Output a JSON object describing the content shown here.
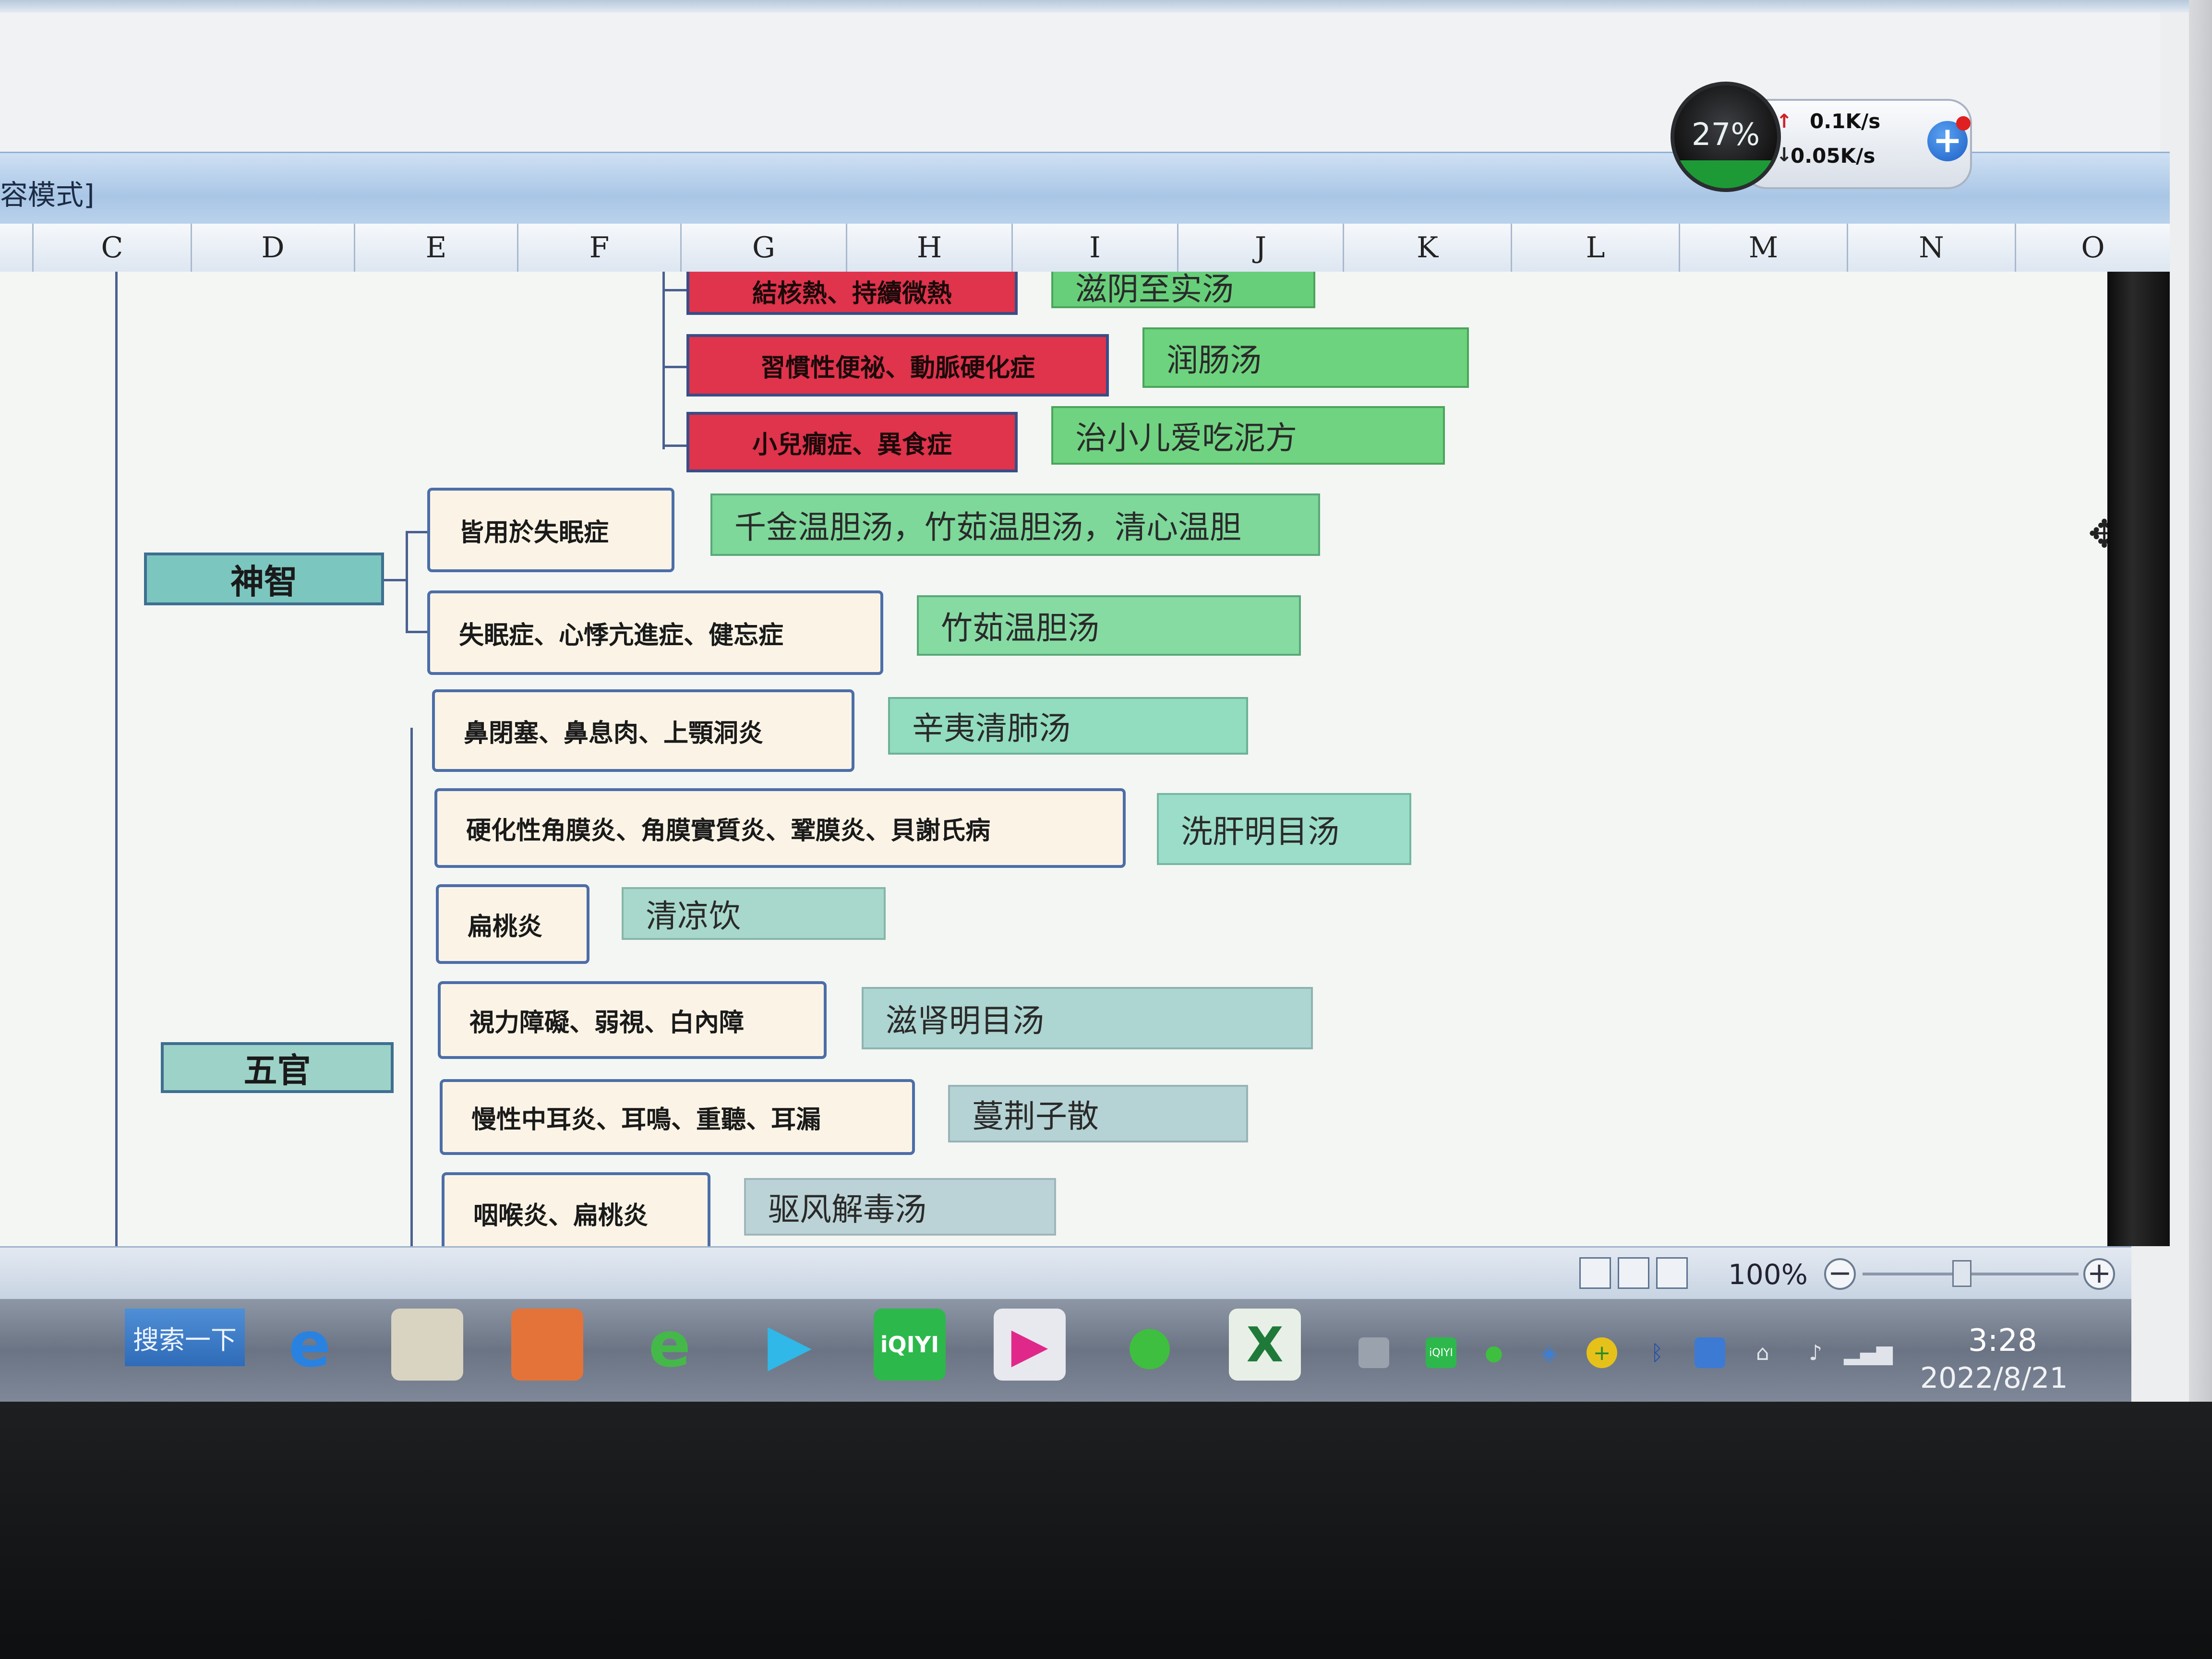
{
  "window": {
    "title_fragment": "容模式]"
  },
  "columns": [
    "C",
    "D",
    "E",
    "F",
    "G",
    "H",
    "I",
    "J",
    "K",
    "L",
    "M",
    "N",
    "O"
  ],
  "mindmap": {
    "red_nodes": [
      {
        "label": "結核熱、持續微熱",
        "remedy": "滋阴至实汤"
      },
      {
        "label": "習慣性便祕、動脈硬化症",
        "remedy": "润肠汤"
      },
      {
        "label": "小兒癇症、異食症",
        "remedy": "治小儿爱吃泥方"
      }
    ],
    "categories": [
      {
        "label": "神智",
        "symptoms": [
          {
            "label": "皆用於失眠症",
            "remedy": "千金温胆汤，竹茹温胆汤，清心温胆"
          },
          {
            "label": "失眠症、心悸亢進症、健忘症",
            "remedy": "竹茹温胆汤"
          }
        ]
      },
      {
        "label": "五官",
        "symptoms": [
          {
            "label": "鼻閉塞、鼻息肉、上顎洞炎",
            "remedy": "辛夷清肺汤"
          },
          {
            "label": "硬化性角膜炎、角膜實質炎、鞏膜炎、貝謝氏病",
            "remedy": "洗肝明目汤"
          },
          {
            "label": "扁桃炎",
            "remedy": "清凉饮"
          },
          {
            "label": "視力障礙、弱視、白內障",
            "remedy": "滋肾明目汤"
          },
          {
            "label": "慢性中耳炎、耳鳴、重聽、耳漏",
            "remedy": "蔓荆子散"
          },
          {
            "label": "咽喉炎、扁桃炎",
            "remedy": "驱风解毒汤"
          }
        ]
      }
    ]
  },
  "net_monitor": {
    "cpu_percent": 27,
    "cpu_label": "27%",
    "upload": "0.1K/s",
    "download": "0.05K/s"
  },
  "status_bar": {
    "zoom": "100%",
    "zoom_fraction": 0.46
  },
  "taskbar": {
    "search_label": "搜索一下",
    "time": "3:28",
    "date": "2022/8/21"
  },
  "colors": {
    "red_node": "#e0334c",
    "symptom_border": "#4c6ea8",
    "category_fill": "#7cc6c0"
  },
  "icons": {
    "taskbar": [
      "ie-icon",
      "file-explorer-icon",
      "media-player-icon",
      "ie-green-icon",
      "video-play-icon",
      "iqiyi-icon",
      "youku-icon",
      "wechat-icon",
      "excel-icon"
    ],
    "tray": [
      "keyboard-icon",
      "iqiyi-tray-icon",
      "wechat-tray-icon",
      "shield-icon",
      "plus-tray-icon",
      "bluetooth-icon",
      "network-icon",
      "usb-icon",
      "volume-icon",
      "signal-icon"
    ]
  }
}
